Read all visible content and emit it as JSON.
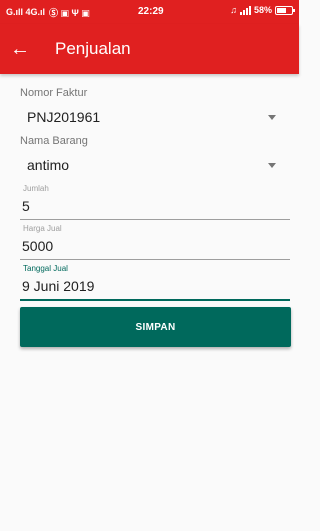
{
  "statusbar": {
    "signal_text": "G.ıll 4G.ıl",
    "notif_icons": "Ⓢ ▣ Ψ ▣",
    "time": "22:29",
    "mute_icon": "♫",
    "battery_text": "58%"
  },
  "appbar": {
    "back_icon": "←",
    "title": "Penjualan"
  },
  "form": {
    "invoice_label": "Nomor Faktur",
    "invoice_value": "PNJ201961",
    "item_label": "Nama Barang",
    "item_value": "antimo",
    "qty_label": "Jumlah",
    "qty_value": "5",
    "price_label": "Harga Jual",
    "price_value": "5000",
    "date_label": "Tanggal Jual",
    "date_value": "9 Juni 2019",
    "save_label": "SIMPAN"
  },
  "colors": {
    "primary": "#e02020",
    "accent": "#00695c"
  }
}
